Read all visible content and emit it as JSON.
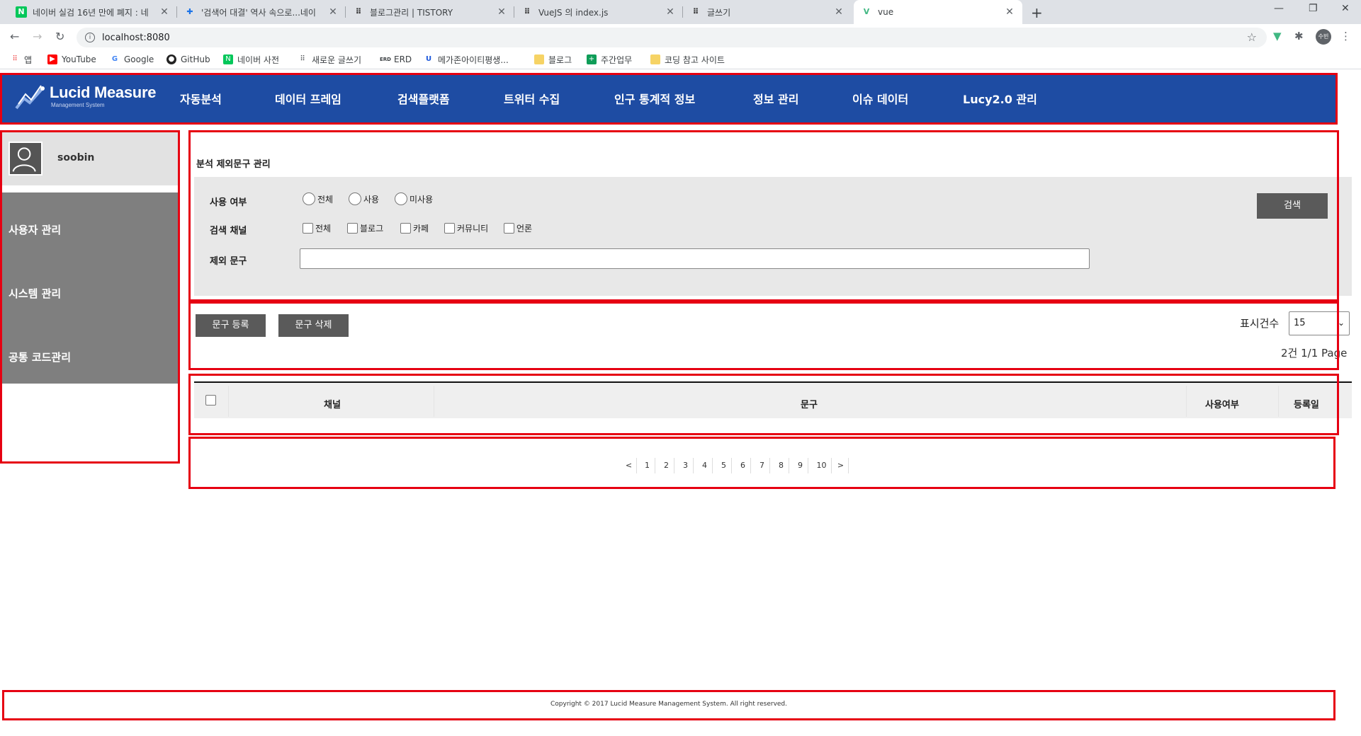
{
  "browser": {
    "tabs": [
      {
        "title": "네이버 실검 16년 만에 폐지 : 네",
        "favicon": "N",
        "active": false
      },
      {
        "title": "'검색어 대결' 역사 속으로...네이",
        "favicon": "✚",
        "active": false
      },
      {
        "title": "블로그관리 | TISTORY",
        "favicon": "⠿",
        "active": false
      },
      {
        "title": "VueJS 의 index.js",
        "favicon": "⠿",
        "active": false
      },
      {
        "title": "글쓰기",
        "favicon": "⠿",
        "active": false
      },
      {
        "title": "vue",
        "favicon": "V",
        "active": true
      }
    ],
    "new_tab": "+",
    "url": "localhost:8080",
    "profile_chip": "수빈",
    "bookmarks": [
      "앱",
      "YouTube",
      "Google",
      "GitHub",
      "네이버 사전",
      "새로운 글쓰기",
      "ERD",
      "메가존아이티평생...",
      "블로그",
      "주간업무",
      "코딩 참고 사이트"
    ]
  },
  "header": {
    "logo_title": "Lucid Measure",
    "logo_subtitle": "Management System",
    "nav": [
      "자동분석",
      "데이터 프레임",
      "검색플랫폼",
      "트위터 수집",
      "인구 통계적 정보",
      "정보 관리",
      "이슈 데이터",
      "Lucy2.0 관리"
    ],
    "brand_color": "#1e4ca3"
  },
  "sidebar": {
    "username": "soobin",
    "items": [
      "사용자 관리",
      "시스템 관리",
      "공통 코드관리"
    ]
  },
  "main": {
    "title": "분석 제외문구 관리",
    "filters": {
      "usage_label": "사용 여부",
      "usage_options": [
        "전체",
        "사용",
        "미사용"
      ],
      "channel_label": "검색 채널",
      "channel_options": [
        "전체",
        "블로그",
        "카페",
        "커뮤니티",
        "언론"
      ],
      "phrase_label": "제외 문구",
      "phrase_value": "",
      "search_button": "검색"
    },
    "actions": {
      "register_button": "문구 등록",
      "delete_button": "문구 삭제",
      "page_size_label": "표시건수",
      "page_size_value": "15",
      "count_info": "2건 1/1 Page"
    },
    "table": {
      "columns": [
        "채널",
        "문구",
        "사용여부",
        "등록일"
      ]
    },
    "pagination": {
      "prev": "<",
      "pages": [
        "1",
        "2",
        "3",
        "4",
        "5",
        "6",
        "7",
        "8",
        "9",
        "10"
      ],
      "next": ">"
    }
  },
  "footer": {
    "copyright": "Copyright © 2017 Lucid Measure Management System. All right reserved."
  }
}
